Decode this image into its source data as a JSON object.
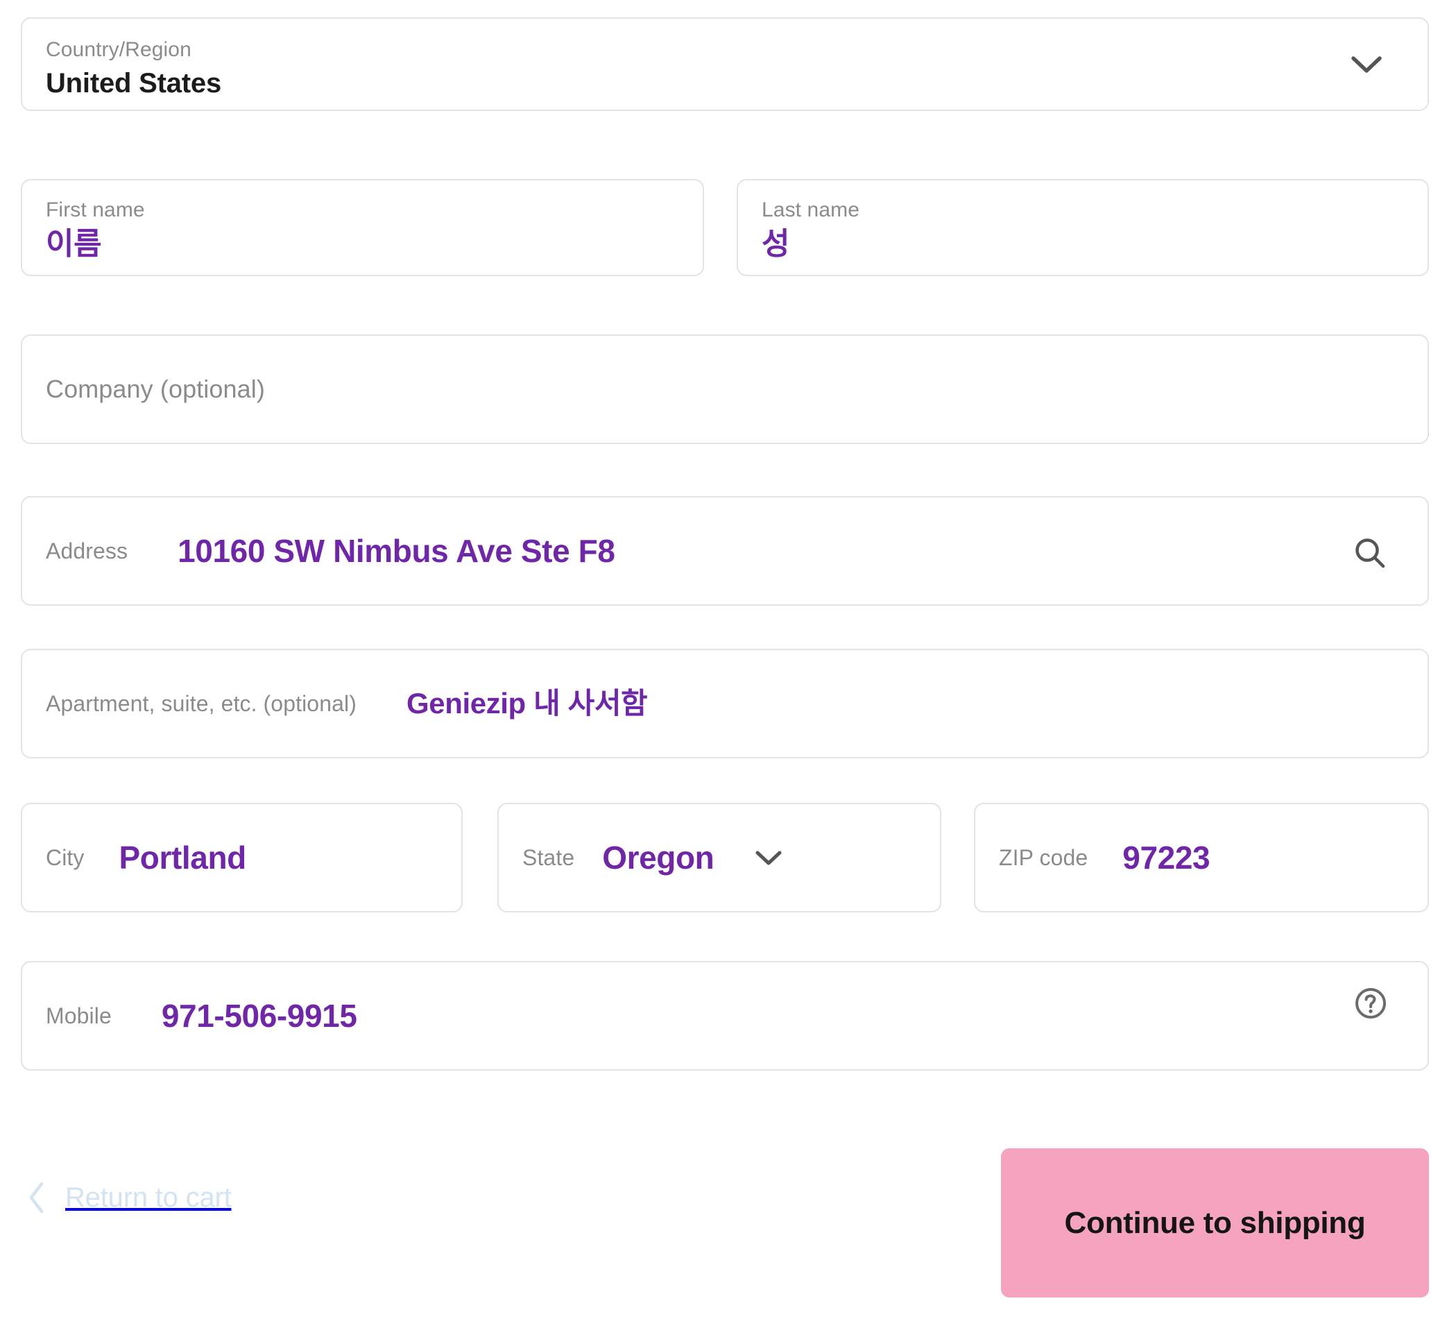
{
  "colors": {
    "accent_value": "#6f27a8",
    "label_gray": "#8b8b8b",
    "field_border": "#e3e3e3",
    "button_bg": "#f6a3bf",
    "button_text": "#151515",
    "return_link": "#d3e3f0",
    "dark_text": "#1c1c1c"
  },
  "form": {
    "country": {
      "label": "Country/Region",
      "value": "United States",
      "chevron_icon": "chevron-down-icon"
    },
    "first_name": {
      "label": "First name",
      "value": "이름",
      "placeholder": "First name"
    },
    "last_name": {
      "label": "Last name",
      "value": "성",
      "placeholder": "Last name"
    },
    "company": {
      "placeholder": "Company (optional)",
      "value": ""
    },
    "address": {
      "label": "Address",
      "value": "10160 SW Nimbus Ave Ste F8",
      "search_icon": "search-icon"
    },
    "apartment": {
      "label": "Apartment, suite, etc. (optional)",
      "value": "Geniezip 내 사서함"
    },
    "city": {
      "label": "City",
      "value": "Portland"
    },
    "state": {
      "label": "State",
      "value": "Oregon",
      "chevron_icon": "chevron-down-icon"
    },
    "zip": {
      "label": "ZIP code",
      "value": "97223"
    },
    "mobile": {
      "label": "Mobile",
      "value": "971-506-9915",
      "help_icon": "help-circle-icon"
    }
  },
  "footer": {
    "return_label": "Return to cart",
    "return_icon": "chevron-left-icon",
    "continue_label": "Continue to shipping"
  }
}
